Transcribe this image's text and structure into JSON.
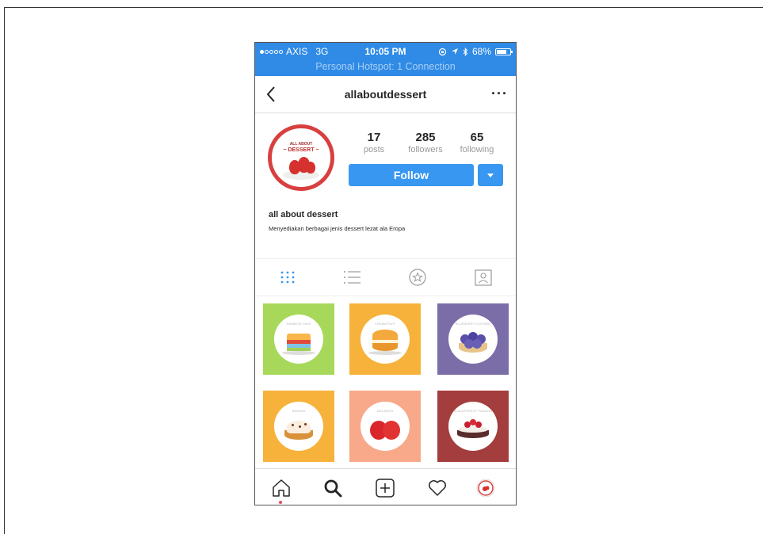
{
  "status_bar": {
    "carrier": "AXIS",
    "network": "3G",
    "time": "10:05 PM",
    "battery": "68%",
    "hotspot": "Personal Hotspot: 1 Connection",
    "signal_bars_filled": 1,
    "signal_bars_total": 5,
    "battery_level": 0.68
  },
  "header": {
    "username": "allaboutdessert",
    "back_icon": "chevron-left-icon",
    "more_icon": "ellipsis-icon",
    "more_label": "···"
  },
  "profile": {
    "avatar_line1": "ALL ABOUT",
    "avatar_line2": "~ DESSERT ~",
    "stats": [
      {
        "value": "17",
        "label": "posts"
      },
      {
        "value": "285",
        "label": "followers"
      },
      {
        "value": "65",
        "label": "following"
      }
    ],
    "follow_label": "Follow",
    "dropdown_icon": "caret-down-icon",
    "name": "all about dessert",
    "bio": "Menyediakan berbagai jenis dessert lezat ala Eropa"
  },
  "tabs": [
    {
      "name": "grid",
      "icon": "grid-icon",
      "active": true
    },
    {
      "name": "list",
      "icon": "list-icon",
      "active": false
    },
    {
      "name": "saved",
      "icon": "star-circle-icon",
      "active": false
    },
    {
      "name": "tagged",
      "icon": "tagged-person-icon",
      "active": false
    }
  ],
  "posts": [
    {
      "bg": "#a8d85a",
      "caption": "RAINBOW CAKE"
    },
    {
      "bg": "#f6b23b",
      "caption": "CREAM PUFF"
    },
    {
      "bg": "#7b6da8",
      "caption": "BLUEBERRY CUSTARD"
    },
    {
      "bg": "#f6b23b",
      "caption": "BAVARIA"
    },
    {
      "bg": "#f8a98a",
      "caption": "MACARON"
    },
    {
      "bg": "#a43d3d",
      "caption": "BLACKFOREST PUDDING"
    }
  ],
  "bottom_nav": [
    {
      "name": "home",
      "icon": "home-icon"
    },
    {
      "name": "search",
      "icon": "search-icon"
    },
    {
      "name": "new-post",
      "icon": "plus-square-icon"
    },
    {
      "name": "activity",
      "icon": "heart-icon"
    },
    {
      "name": "profile",
      "icon": "avatar-icon"
    }
  ],
  "colors": {
    "accent": "#3897f0",
    "status_bar": "#2f8be6",
    "avatar_ring": "#d7403f",
    "notification": "#ed4956"
  }
}
